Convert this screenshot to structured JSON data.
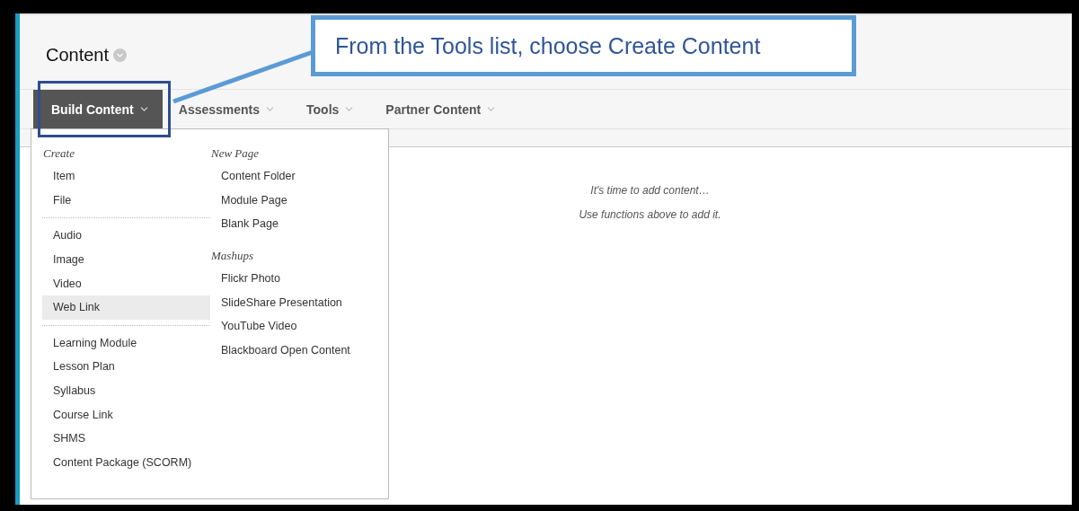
{
  "page": {
    "title": "Content"
  },
  "toolbar": [
    {
      "label": "Build Content",
      "selected": true
    },
    {
      "label": "Assessments",
      "selected": false
    },
    {
      "label": "Tools",
      "selected": false
    },
    {
      "label": "Partner Content",
      "selected": false
    }
  ],
  "menu": {
    "left": {
      "heading": "Create",
      "groups": [
        [
          {
            "label": "Item",
            "selected": false
          },
          {
            "label": "File",
            "selected": false
          }
        ],
        [
          {
            "label": "Audio",
            "selected": false
          },
          {
            "label": "Image",
            "selected": false
          },
          {
            "label": "Video",
            "selected": false
          },
          {
            "label": "Web Link",
            "selected": true
          }
        ],
        [
          {
            "label": "Learning Module",
            "selected": false
          },
          {
            "label": "Lesson Plan",
            "selected": false
          },
          {
            "label": "Syllabus",
            "selected": false
          },
          {
            "label": "Course Link",
            "selected": false
          },
          {
            "label": "SHMS",
            "selected": false
          },
          {
            "label": "Content Package (SCORM)",
            "selected": false
          }
        ]
      ]
    },
    "right": [
      {
        "heading": "New Page",
        "items": [
          {
            "label": "Content Folder",
            "selected": false
          },
          {
            "label": "Module Page",
            "selected": false
          },
          {
            "label": "Blank Page",
            "selected": false
          }
        ]
      },
      {
        "heading": "Mashups",
        "items": [
          {
            "label": "Flickr Photo",
            "selected": false
          },
          {
            "label": "SlideShare Presentation",
            "selected": false
          },
          {
            "label": "YouTube Video",
            "selected": false
          },
          {
            "label": "Blackboard Open Content",
            "selected": false
          }
        ]
      }
    ]
  },
  "empty_state": [
    "It's time to add content…",
    "Use functions above to add it."
  ],
  "callout": {
    "text": "From the Tools list, choose Create Content"
  }
}
